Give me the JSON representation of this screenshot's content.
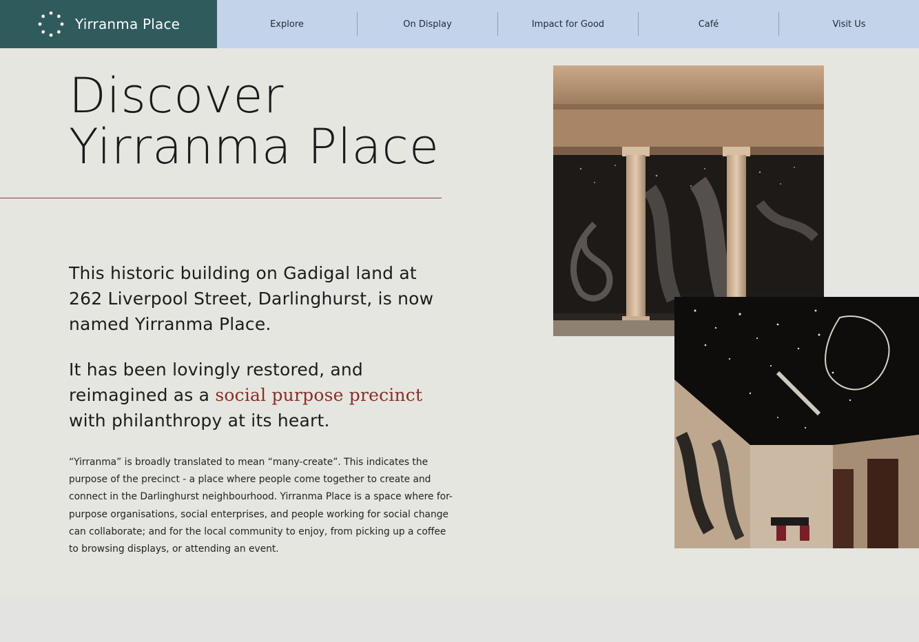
{
  "header": {
    "brand_name": "Yirranma Place",
    "nav": [
      {
        "label": "Explore"
      },
      {
        "label": "On Display"
      },
      {
        "label": "Impact for Good"
      },
      {
        "label": "Café"
      },
      {
        "label": "Visit Us"
      }
    ]
  },
  "hero": {
    "title_line1": "Discover",
    "title_line2": "Yirranma Place"
  },
  "intro": {
    "paragraph1": "This historic building on Gadigal land at 262 Liverpool Street, Darlinghurst, is now named Yirranma Place.",
    "paragraph2_before": "It has been lovingly restored, and reimagined as a ",
    "paragraph2_link": "social purpose precinct",
    "paragraph2_after": " with philanthropy at its heart.",
    "body": "“Yirranma” is broadly translated to mean “many-create”. This indicates the purpose of the precinct - a place where people come together to create and connect in the Darlinghurst neighbourhood. Yirranma Place is a space where for-purpose organisations, social enterprises, and people working for social change can collaborate; and for the local community to enjoy, from picking up a coffee to browsing displays, or attending an event."
  },
  "colors": {
    "brand_bg": "#2f5b5d",
    "nav_bg": "#c3d3ea",
    "page_bg": "#e6e6e1",
    "accent": "#8a2e25"
  },
  "icons": {
    "logo": "dotted-circle-icon"
  }
}
